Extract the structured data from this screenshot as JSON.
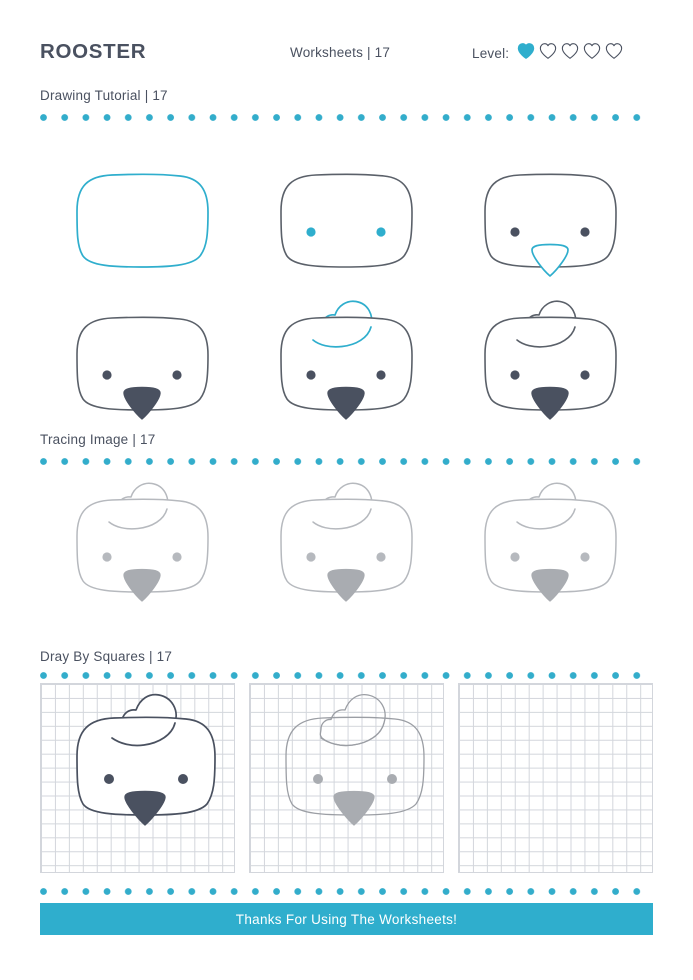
{
  "header": {
    "title": "ROOSTER",
    "worksheets_label": "Worksheets | 17",
    "level_label": "Level:",
    "level_filled": 1,
    "level_total": 5,
    "heart_icon": "heart-icon"
  },
  "colors": {
    "teal": "#2faecd",
    "teal_line": "#33adcb",
    "dark": "#4a5160",
    "ink": "#4a5160",
    "trace_gray": "#b6b9be",
    "trace_fill": "#a9acb1",
    "grid_line": "#d3d6dc",
    "white": "#ffffff"
  },
  "sections": [
    {
      "id": "drawing-tutorial",
      "label": "Drawing Tutorial | 17"
    },
    {
      "id": "tracing-image",
      "label": "Tracing Image | 17"
    },
    {
      "id": "draw-by-squares",
      "label": "Dray By Squares | 17"
    }
  ],
  "tutorial": {
    "steps": [
      {
        "index": 1,
        "name": "step-head-outline",
        "parts": {
          "head": "teal-outline",
          "eyes": "none",
          "beak": "none",
          "comb": "none"
        }
      },
      {
        "index": 2,
        "name": "step-eyes",
        "parts": {
          "head": "dark-outline",
          "eyes": "teal",
          "beak": "none",
          "comb": "none"
        }
      },
      {
        "index": 3,
        "name": "step-beak-outline",
        "parts": {
          "head": "dark-outline",
          "eyes": "dark",
          "beak": "teal-outline",
          "comb": "none"
        }
      },
      {
        "index": 4,
        "name": "step-beak-filled",
        "parts": {
          "head": "dark-outline",
          "eyes": "dark",
          "beak": "dark-fill",
          "comb": "none"
        }
      },
      {
        "index": 5,
        "name": "step-comb-outline",
        "parts": {
          "head": "dark-outline",
          "eyes": "dark",
          "beak": "dark-fill",
          "comb": "teal-outline"
        }
      },
      {
        "index": 6,
        "name": "step-complete",
        "parts": {
          "head": "dark-outline",
          "eyes": "dark",
          "beak": "dark-fill",
          "comb": "dark-outline"
        }
      }
    ]
  },
  "tracing": {
    "count": 3,
    "style": "light-gray-outline"
  },
  "squares": {
    "panels": [
      {
        "index": 1,
        "name": "grid-panel-reference",
        "art": "dark"
      },
      {
        "index": 2,
        "name": "grid-panel-trace",
        "art": "light"
      },
      {
        "index": 3,
        "name": "grid-panel-blank",
        "art": "none"
      }
    ],
    "cell_size_px": 14,
    "columns": 14,
    "rows": 13
  },
  "footer": {
    "message": "Thanks For Using The Worksheets!"
  }
}
